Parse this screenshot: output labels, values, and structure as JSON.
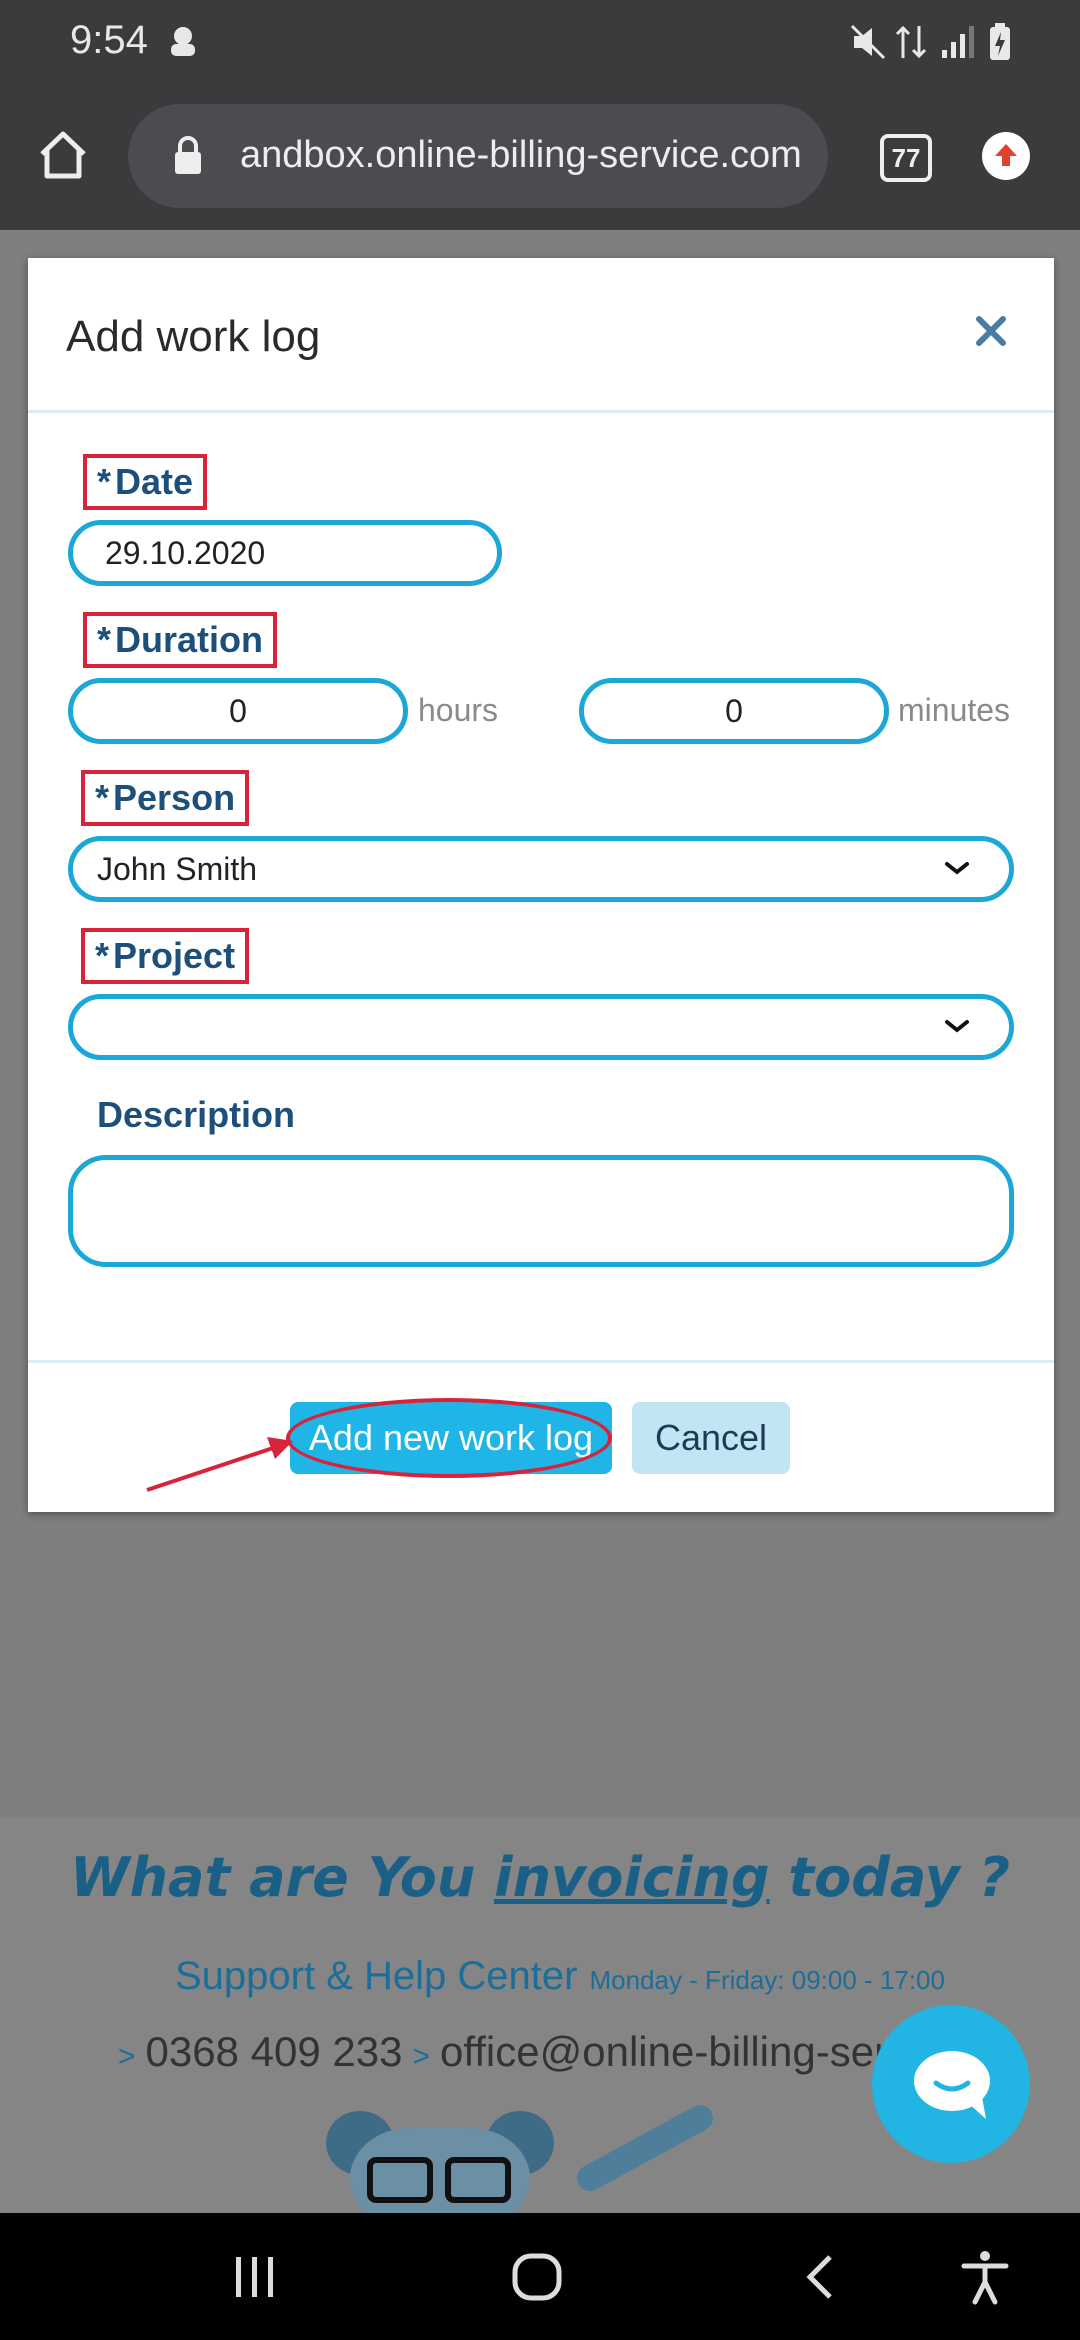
{
  "status_bar": {
    "time": "9:54"
  },
  "browser": {
    "url": "andbox.online-billing-service.com",
    "tab_count": "77"
  },
  "modal": {
    "title": "Add work log",
    "fields": {
      "date": {
        "label": "Date",
        "value": "29.10.2020"
      },
      "duration": {
        "label": "Duration",
        "hours_value": "0",
        "hours_unit": "hours",
        "minutes_value": "0",
        "minutes_unit": "minutes"
      },
      "person": {
        "label": "Person",
        "value": "John Smith"
      },
      "project": {
        "label": "Project",
        "value": ""
      },
      "description": {
        "label": "Description",
        "value": ""
      }
    },
    "required_marker": "*",
    "buttons": {
      "add": "Add new work log",
      "cancel": "Cancel"
    }
  },
  "footer": {
    "tagline_part1": "What are You ",
    "tagline_em": "invoicing",
    "tagline_part2": " today ?",
    "support_title": "Support & Help Center",
    "support_hours": "Monday - Friday: 09:00 - 17:00",
    "phone": "0368 409 233",
    "email": "office@online-billing-service",
    "sep": ">"
  },
  "colors": {
    "accent": "#1fb5e6",
    "annotation": "#d8233b",
    "label": "#1c4f7a"
  }
}
